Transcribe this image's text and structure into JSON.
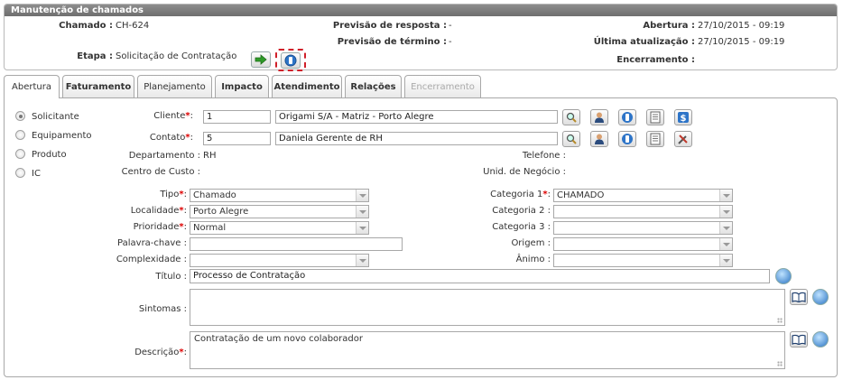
{
  "panel": {
    "title": "Manutenção de chamados",
    "chamado_label": "Chamado :",
    "chamado_value": "CH-624",
    "etapa_label": "Etapa :",
    "etapa_value": "Solicitação de Contratação",
    "prev_resp_label": "Previsão de resposta :",
    "prev_resp_value": "-",
    "prev_term_label": "Previsão de término :",
    "prev_term_value": "-",
    "abertura_label": "Abertura :",
    "abertura_value": "27/10/2015 - 09:19",
    "ultima_label": "Última atualização :",
    "ultima_value": "27/10/2015 - 09:19",
    "encerramento_label": "Encerramento :",
    "encerramento_value": ""
  },
  "tabs": [
    {
      "label": "Abertura"
    },
    {
      "label": "Faturamento"
    },
    {
      "label": "Planejamento"
    },
    {
      "label": "Impacto"
    },
    {
      "label": "Atendimento"
    },
    {
      "label": "Relações"
    },
    {
      "label": "Encerramento"
    }
  ],
  "radios": [
    {
      "label": "Solicitante",
      "selected": true
    },
    {
      "label": "Equipamento",
      "selected": false
    },
    {
      "label": "Produto",
      "selected": false
    },
    {
      "label": "IC",
      "selected": false
    }
  ],
  "form": {
    "cliente_label": "Cliente",
    "cliente_id": "1",
    "cliente_name": "Origami S/A - Matriz - Porto Alegre",
    "contato_label": "Contato",
    "contato_id": "5",
    "contato_name": "Daniela Gerente de RH",
    "departamento_label": "Departamento :",
    "departamento_value": "RH",
    "telefone_label": "Telefone :",
    "telefone_value": "",
    "centro_label": "Centro de Custo :",
    "centro_value": "",
    "unid_label": "Unid. de Negócio :",
    "unid_value": "",
    "tipo_label": "Tipo",
    "tipo_value": "Chamado",
    "localidade_label": "Localidade",
    "localidade_value": "Porto Alegre",
    "prioridade_label": "Prioridade",
    "prioridade_value": "Normal",
    "palavra_label": "Palavra-chave :",
    "palavra_value": "",
    "complexidade_label": "Complexidade :",
    "complexidade_value": "",
    "cat1_label": "Categoria 1",
    "cat1_value": "CHAMADO",
    "cat2_label": "Categoria 2 :",
    "cat2_value": "",
    "cat3_label": "Categoria 3 :",
    "cat3_value": "",
    "origem_label": "Origem :",
    "origem_value": "",
    "animo_label": "Ânimo :",
    "animo_value": "",
    "titulo_label": "Título :",
    "titulo_value": "Processo de Contratação",
    "sintomas_label": "Sintomas :",
    "sintomas_value": "",
    "descricao_label": "Descrição",
    "descricao_value": "Contratação de um novo colaborador",
    "required_mark": "*",
    "colon": ":"
  }
}
